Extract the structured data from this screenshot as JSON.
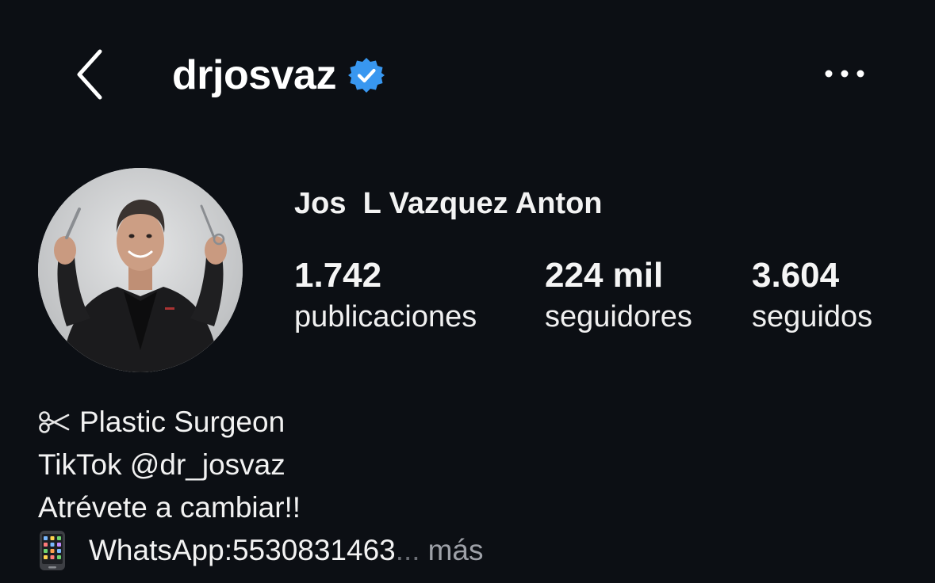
{
  "header": {
    "username": "drjosvaz",
    "back_icon": "chevron-left-icon",
    "verified_icon": "verified-badge-icon",
    "more_icon": "more-horizontal-icon"
  },
  "profile": {
    "full_name": "Jos  L Vazquez Anton",
    "stats": [
      {
        "value": "1.742",
        "label": "publicaciones"
      },
      {
        "value": "224 mil",
        "label": "seguidores"
      },
      {
        "value": "3.604",
        "label": "seguidos"
      }
    ]
  },
  "bio": {
    "line1_icon": "scissors-icon",
    "line1": "Plastic Surgeon",
    "line2": "TikTok @dr_josvaz",
    "line3": "Atrévete a cambiar!!",
    "line4_icon": "mobile-phone-icon",
    "line4": "WhatsApp:5530831463",
    "ellipsis": "...",
    "more": "más"
  },
  "colors": {
    "background": "#0c0f14",
    "verified_blue": "#3897f0",
    "muted_text": "#9ea1a8"
  }
}
